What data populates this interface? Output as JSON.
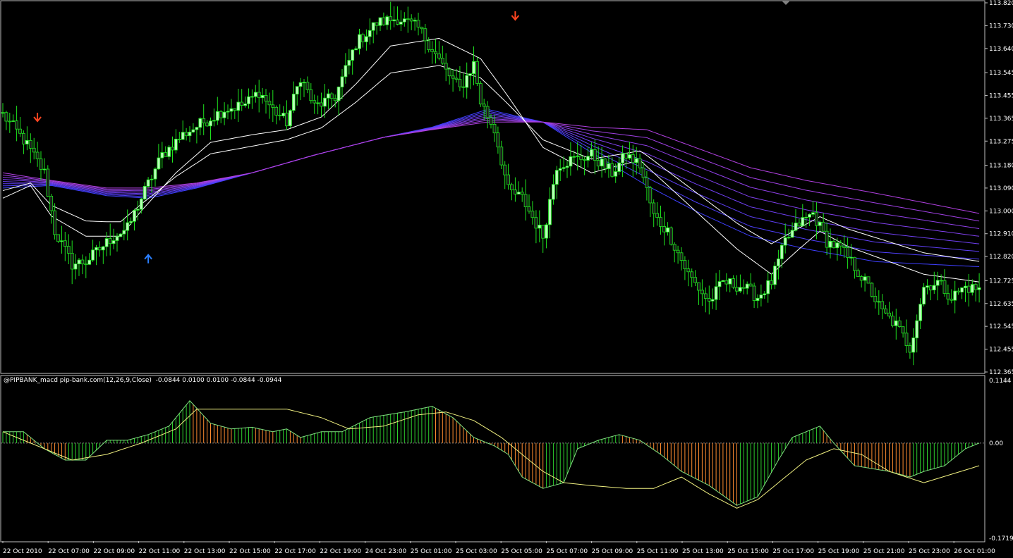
{
  "indicator": {
    "label": "@PIPBANK_macd pip-bank.com(12,26,9,Close)",
    "values_text": "-0.0844 0.0100 0.0100 -0.0844 -0.0944"
  },
  "colors": {
    "background": "#000000",
    "frame": "#c0c0c0",
    "bull_candle": "#b8ffb8",
    "bear_candle": "#1c1c1c",
    "wick": "#1ee21e",
    "ma_fast": "#ffffff",
    "ma_slow_start": "#3f3fff",
    "ma_slow_end": "#b040e0",
    "hist_up": "#2ecf2e",
    "hist_down": "#ff8c30",
    "signal_line": "#f0f080",
    "macd_line": "#7fdf7f",
    "sell_arrow": "#ff4520",
    "buy_arrow": "#2a7fff",
    "text": "#ffffff"
  },
  "chart_data": [
    {
      "type": "candlestick",
      "symbol_desc": "price chart with EMA ribbon",
      "y_ticks": [
        "113.820",
        "113.730",
        "113.640",
        "113.545",
        "113.455",
        "113.365",
        "113.275",
        "113.180",
        "113.090",
        "113.000",
        "112.910",
        "112.820",
        "112.725",
        "112.635",
        "112.545",
        "112.455",
        "112.365"
      ],
      "ylim": [
        112.365,
        113.82
      ],
      "x_ticks": [
        "22 Oct 2010",
        "22 Oct 07:00",
        "22 Oct 09:00",
        "22 Oct 11:00",
        "22 Oct 13:00",
        "22 Oct 15:00",
        "22 Oct 17:00",
        "22 Oct 19:00",
        "24 Oct 23:00",
        "25 Oct 01:00",
        "25 Oct 03:00",
        "25 Oct 05:00",
        "25 Oct 07:00",
        "25 Oct 09:00",
        "25 Oct 11:00",
        "25 Oct 13:00",
        "25 Oct 15:00",
        "25 Oct 17:00",
        "25 Oct 19:00",
        "25 Oct 21:00",
        "25 Oct 23:00",
        "26 Oct 01:00"
      ],
      "close_keypoints": [
        [
          0,
          113.38
        ],
        [
          6,
          113.28
        ],
        [
          12,
          113.15
        ],
        [
          15,
          112.92
        ],
        [
          20,
          112.79
        ],
        [
          24,
          112.8
        ],
        [
          28,
          112.85
        ],
        [
          32,
          112.9
        ],
        [
          36,
          112.93
        ],
        [
          40,
          113.05
        ],
        [
          46,
          113.22
        ],
        [
          52,
          113.3
        ],
        [
          58,
          113.35
        ],
        [
          64,
          113.4
        ],
        [
          70,
          113.42
        ],
        [
          74,
          113.47
        ],
        [
          78,
          113.4
        ],
        [
          82,
          113.35
        ],
        [
          86,
          113.53
        ],
        [
          90,
          113.41
        ],
        [
          96,
          113.45
        ],
        [
          102,
          113.66
        ],
        [
          108,
          113.74
        ],
        [
          114,
          113.76
        ],
        [
          120,
          113.72
        ],
        [
          124,
          113.64
        ],
        [
          128,
          113.55
        ],
        [
          132,
          113.48
        ],
        [
          136,
          113.58
        ],
        [
          138,
          113.43
        ],
        [
          142,
          113.32
        ],
        [
          146,
          113.08
        ],
        [
          150,
          113.05
        ],
        [
          156,
          112.9
        ],
        [
          160,
          113.18
        ],
        [
          164,
          113.2
        ],
        [
          170,
          113.22
        ],
        [
          176,
          113.15
        ],
        [
          180,
          113.22
        ],
        [
          184,
          113.18
        ],
        [
          188,
          112.98
        ],
        [
          192,
          112.92
        ],
        [
          198,
          112.75
        ],
        [
          204,
          112.64
        ],
        [
          208,
          112.72
        ],
        [
          214,
          112.7
        ],
        [
          218,
          112.66
        ],
        [
          222,
          112.72
        ],
        [
          226,
          112.88
        ],
        [
          230,
          112.95
        ],
        [
          234,
          112.99
        ],
        [
          238,
          112.88
        ],
        [
          242,
          112.85
        ],
        [
          246,
          112.78
        ],
        [
          250,
          112.7
        ],
        [
          254,
          112.6
        ],
        [
          258,
          112.55
        ],
        [
          262,
          112.46
        ],
        [
          266,
          112.7
        ],
        [
          270,
          112.72
        ],
        [
          274,
          112.66
        ],
        [
          278,
          112.7
        ],
        [
          282,
          112.69
        ]
      ],
      "ma_fast_keypoints": [
        [
          0,
          113.05
        ],
        [
          8,
          113.1
        ],
        [
          14,
          112.98
        ],
        [
          24,
          112.9
        ],
        [
          34,
          112.9
        ],
        [
          40,
          113.0
        ],
        [
          50,
          113.15
        ],
        [
          60,
          113.27
        ],
        [
          72,
          113.3
        ],
        [
          82,
          113.32
        ],
        [
          92,
          113.37
        ],
        [
          102,
          113.5
        ],
        [
          112,
          113.65
        ],
        [
          126,
          113.68
        ],
        [
          138,
          113.6
        ],
        [
          146,
          113.45
        ],
        [
          156,
          113.25
        ],
        [
          170,
          113.15
        ],
        [
          184,
          113.2
        ],
        [
          196,
          113.05
        ],
        [
          212,
          112.85
        ],
        [
          222,
          112.75
        ],
        [
          230,
          112.85
        ],
        [
          236,
          112.92
        ],
        [
          244,
          112.86
        ],
        [
          256,
          112.8
        ],
        [
          266,
          112.75
        ],
        [
          282,
          112.72
        ]
      ],
      "ma_slow_top_keypoints": [
        [
          0,
          113.15
        ],
        [
          14,
          113.12
        ],
        [
          30,
          113.09
        ],
        [
          42,
          113.09
        ],
        [
          56,
          113.11
        ],
        [
          72,
          113.15
        ],
        [
          90,
          113.22
        ],
        [
          110,
          113.29
        ],
        [
          124,
          113.32
        ],
        [
          140,
          113.35
        ],
        [
          156,
          113.35
        ],
        [
          170,
          113.33
        ],
        [
          186,
          113.32
        ],
        [
          200,
          113.25
        ],
        [
          216,
          113.17
        ],
        [
          232,
          113.12
        ],
        [
          252,
          113.07
        ],
        [
          282,
          112.99
        ]
      ],
      "ma_slow_bottom_keypoints": [
        [
          0,
          113.09
        ],
        [
          14,
          113.1
        ],
        [
          30,
          113.06
        ],
        [
          42,
          113.05
        ],
        [
          56,
          113.09
        ],
        [
          72,
          113.15
        ],
        [
          90,
          113.22
        ],
        [
          110,
          113.29
        ],
        [
          124,
          113.33
        ],
        [
          140,
          113.4
        ],
        [
          156,
          113.35
        ],
        [
          170,
          113.23
        ],
        [
          186,
          113.1
        ],
        [
          200,
          113.0
        ],
        [
          216,
          112.9
        ],
        [
          232,
          112.85
        ],
        [
          252,
          112.8
        ],
        [
          282,
          112.78
        ]
      ],
      "markers": [
        {
          "type": "sell",
          "bar": 10,
          "price": 113.37
        },
        {
          "type": "buy",
          "bar": 42,
          "price": 112.81
        },
        {
          "type": "sell",
          "bar": 148,
          "price": 113.77
        }
      ]
    },
    {
      "type": "histogram",
      "name": "@PIPBANK_macd pip-bank.com(12,26,9,Close)",
      "y_ticks": [
        "0.1144",
        "0.00",
        "-0.1719"
      ],
      "ylim": [
        -0.1719,
        0.1144
      ],
      "macd_keypoints": [
        [
          0,
          0.02
        ],
        [
          6,
          0.02
        ],
        [
          12,
          -0.01
        ],
        [
          18,
          -0.03
        ],
        [
          24,
          -0.03
        ],
        [
          30,
          0.005
        ],
        [
          36,
          0.005
        ],
        [
          42,
          0.015
        ],
        [
          48,
          0.03
        ],
        [
          54,
          0.075
        ],
        [
          60,
          0.035
        ],
        [
          66,
          0.025
        ],
        [
          72,
          0.028
        ],
        [
          78,
          0.02
        ],
        [
          82,
          0.025
        ],
        [
          86,
          0.01
        ],
        [
          92,
          0.02
        ],
        [
          98,
          0.02
        ],
        [
          106,
          0.045
        ],
        [
          116,
          0.055
        ],
        [
          124,
          0.065
        ],
        [
          130,
          0.045
        ],
        [
          136,
          0.01
        ],
        [
          142,
          -0.005
        ],
        [
          146,
          -0.02
        ],
        [
          150,
          -0.06
        ],
        [
          156,
          -0.08
        ],
        [
          162,
          -0.07
        ],
        [
          166,
          -0.01
        ],
        [
          172,
          0.005
        ],
        [
          178,
          0.015
        ],
        [
          184,
          0.005
        ],
        [
          190,
          -0.02
        ],
        [
          196,
          -0.05
        ],
        [
          204,
          -0.075
        ],
        [
          212,
          -0.11
        ],
        [
          218,
          -0.095
        ],
        [
          224,
          -0.03
        ],
        [
          228,
          0.01
        ],
        [
          236,
          0.03
        ],
        [
          240,
          0.0
        ],
        [
          246,
          -0.04
        ],
        [
          256,
          -0.05
        ],
        [
          262,
          -0.06
        ],
        [
          266,
          -0.05
        ],
        [
          272,
          -0.04
        ],
        [
          278,
          -0.01
        ],
        [
          282,
          0.0
        ]
      ],
      "signal_keypoints": [
        [
          0,
          0.02
        ],
        [
          10,
          -0.005
        ],
        [
          20,
          -0.03
        ],
        [
          30,
          -0.02
        ],
        [
          40,
          0.0
        ],
        [
          50,
          0.025
        ],
        [
          56,
          0.06
        ],
        [
          62,
          0.06
        ],
        [
          72,
          0.06
        ],
        [
          82,
          0.06
        ],
        [
          92,
          0.045
        ],
        [
          100,
          0.025
        ],
        [
          110,
          0.03
        ],
        [
          120,
          0.05
        ],
        [
          128,
          0.055
        ],
        [
          136,
          0.04
        ],
        [
          144,
          0.01
        ],
        [
          150,
          -0.02
        ],
        [
          156,
          -0.05
        ],
        [
          162,
          -0.07
        ],
        [
          170,
          -0.075
        ],
        [
          180,
          -0.08
        ],
        [
          188,
          -0.08
        ],
        [
          196,
          -0.06
        ],
        [
          204,
          -0.09
        ],
        [
          212,
          -0.115
        ],
        [
          218,
          -0.1
        ],
        [
          224,
          -0.07
        ],
        [
          232,
          -0.03
        ],
        [
          240,
          -0.01
        ],
        [
          248,
          -0.02
        ],
        [
          256,
          -0.05
        ],
        [
          266,
          -0.07
        ],
        [
          274,
          -0.055
        ],
        [
          282,
          -0.04
        ]
      ]
    }
  ]
}
